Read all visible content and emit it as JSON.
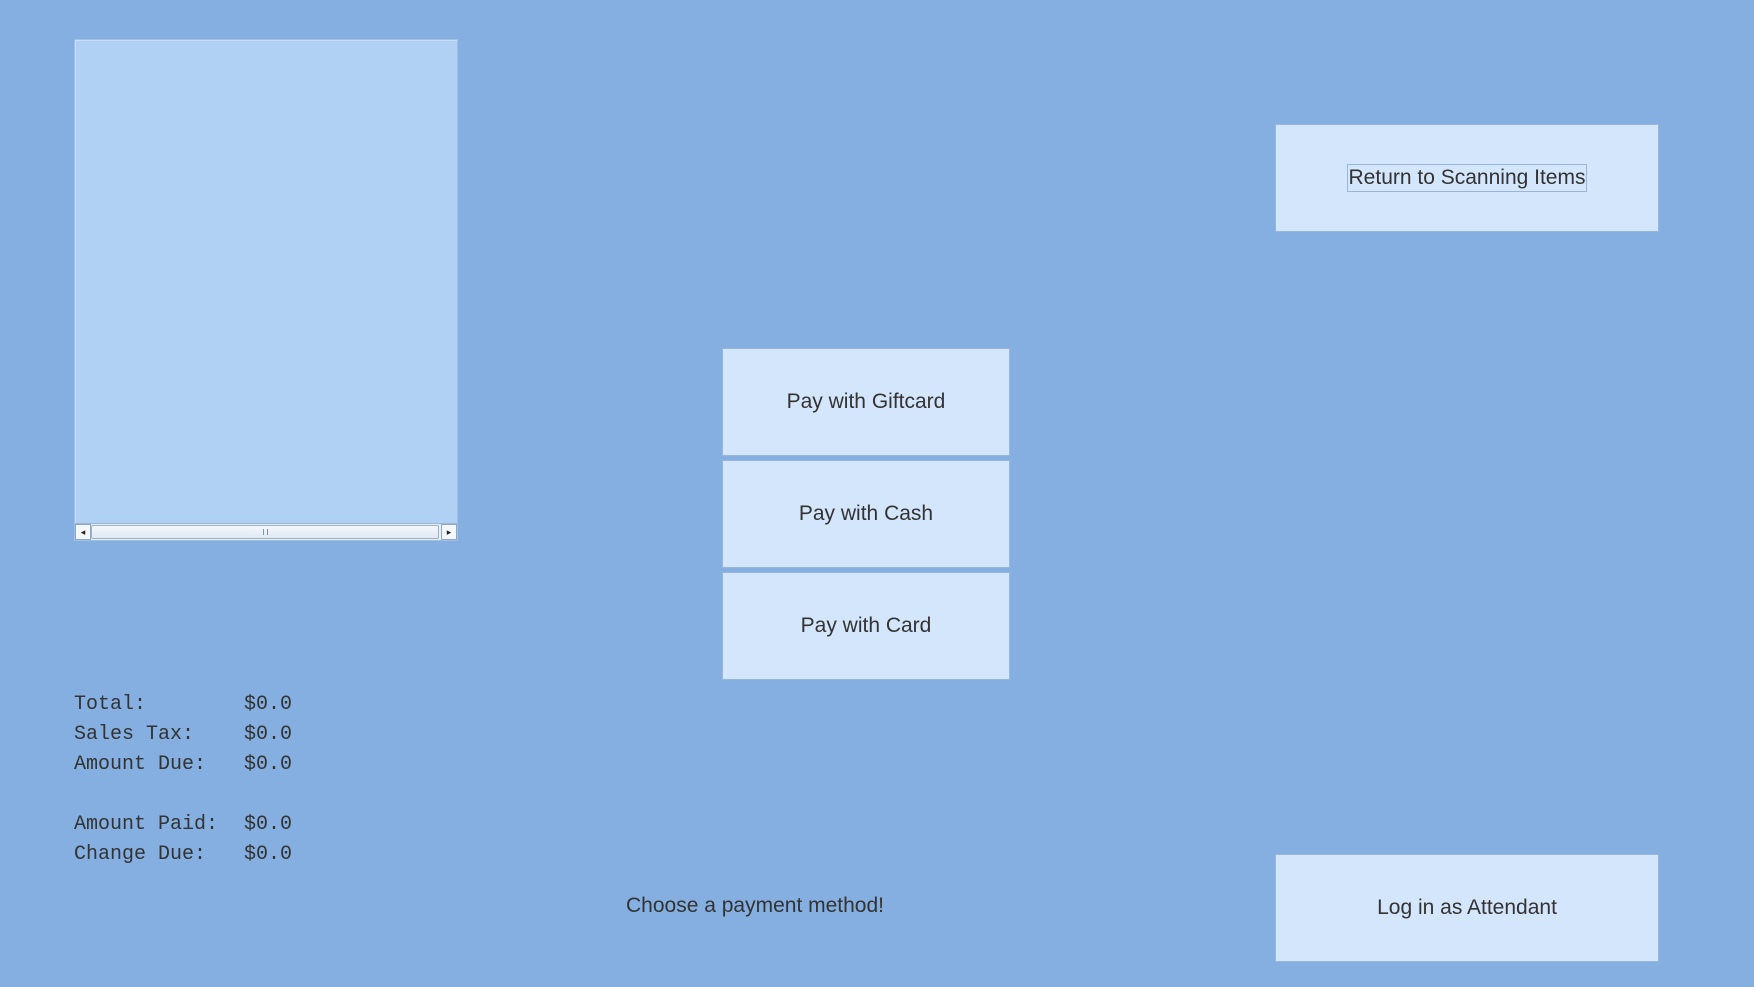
{
  "items_panel": {
    "scroll_left_glyph": "◂",
    "scroll_right_glyph": "▸",
    "items": []
  },
  "totals": {
    "total_label": "Total:",
    "total_value": "$0.0",
    "sales_tax_label": "Sales Tax:",
    "sales_tax_value": "$0.0",
    "amount_due_label": "Amount Due:",
    "amount_due_value": "$0.0",
    "amount_paid_label": "Amount Paid:",
    "amount_paid_value": "$0.0",
    "change_due_label": "Change Due:",
    "change_due_value": "$0.0"
  },
  "payment": {
    "giftcard_label": "Pay with Giftcard",
    "cash_label": "Pay with Cash",
    "card_label": "Pay with Card",
    "status_message": "Choose a payment method!"
  },
  "actions": {
    "return_label": "Return to Scanning Items",
    "attendant_label": "Log in as Attendant"
  },
  "colors": {
    "background": "#84afe0",
    "panel": "#b0d0f4",
    "button": "#d4e6fc",
    "button_border": "#9ab6d8",
    "text": "#333333"
  }
}
